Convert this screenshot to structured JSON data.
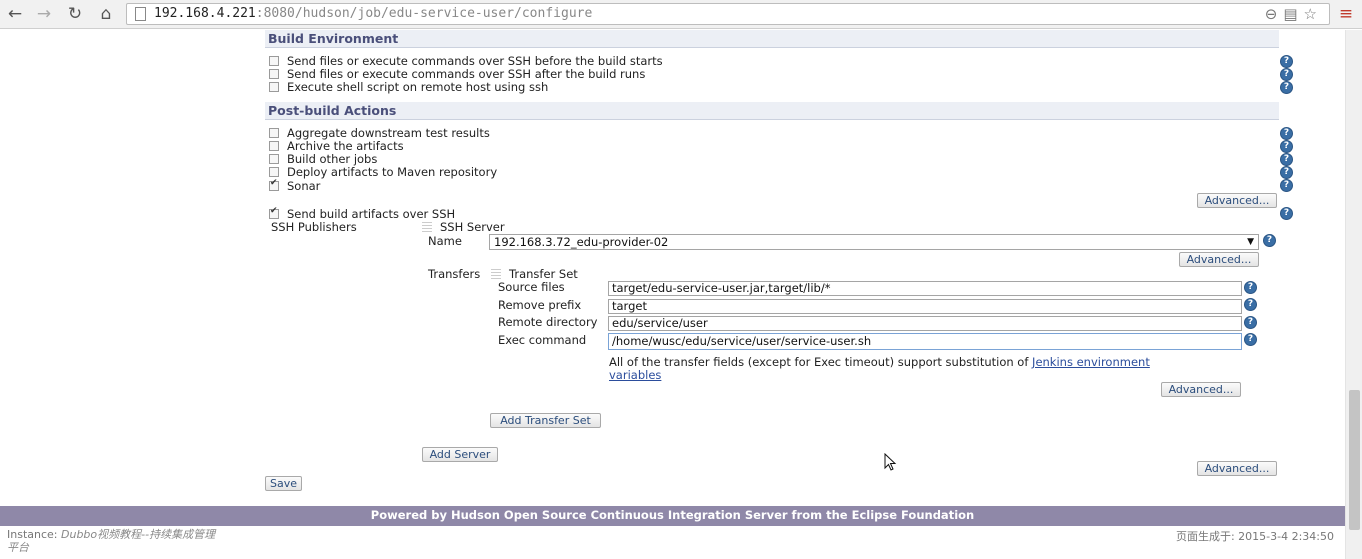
{
  "browser": {
    "url_host": "192.168.4.221",
    "url_rest": ":8080/hudson/job/edu-service-user/configure"
  },
  "build_environment": {
    "title": "Build Environment",
    "options": [
      {
        "label": "Send files or execute commands over SSH before the build starts",
        "checked": false
      },
      {
        "label": "Send files or execute commands over SSH after the build runs",
        "checked": false
      },
      {
        "label": "Execute shell script on remote host using ssh",
        "checked": false
      }
    ]
  },
  "post_build": {
    "title": "Post-build Actions",
    "options": [
      {
        "label": "Aggregate downstream test results",
        "checked": false
      },
      {
        "label": "Archive the artifacts",
        "checked": false
      },
      {
        "label": "Build other jobs",
        "checked": false
      },
      {
        "label": "Deploy artifacts to Maven repository",
        "checked": false
      },
      {
        "label": "Sonar",
        "checked": true
      }
    ],
    "advanced_label": "Advanced...",
    "ssh_artifacts_label": "Send build artifacts over SSH"
  },
  "ssh": {
    "publishers_label": "SSH Publishers",
    "server_label": "SSH Server",
    "name_label": "Name",
    "name_value": "192.168.3.72_edu-provider-02",
    "advanced_label": "Advanced...",
    "transfers_label": "Transfers",
    "transfer_set_label": "Transfer Set",
    "source_files_label": "Source files",
    "source_files_value": "target/edu-service-user.jar,target/lib/*",
    "remove_prefix_label": "Remove prefix",
    "remove_prefix_value": "target",
    "remote_directory_label": "Remote directory",
    "remote_directory_value": "edu/service/user",
    "exec_command_label": "Exec command",
    "exec_command_value": "/home/wusc/edu/service/user/service-user.sh",
    "note_text": "All of the transfer fields (except for Exec timeout) support substitution of ",
    "note_link_1": "Jenkins environment",
    "note_link_2": "variables",
    "transfer_advanced_label": "Advanced...",
    "add_transfer_set_label": "Add Transfer Set",
    "add_server_label": "Add Server",
    "server_advanced_label": "Advanced..."
  },
  "save_label": "Save",
  "footer": {
    "powered_by": "Powered by Hudson Open Source Continuous Integration Server from the Eclipse Foundation",
    "instance_label": "Instance:",
    "instance_value_1": "Dubbo视频教程--持续集成管理",
    "instance_value_2": "平台",
    "generated": "页面生成于: 2015-3-4 2:34:50"
  }
}
